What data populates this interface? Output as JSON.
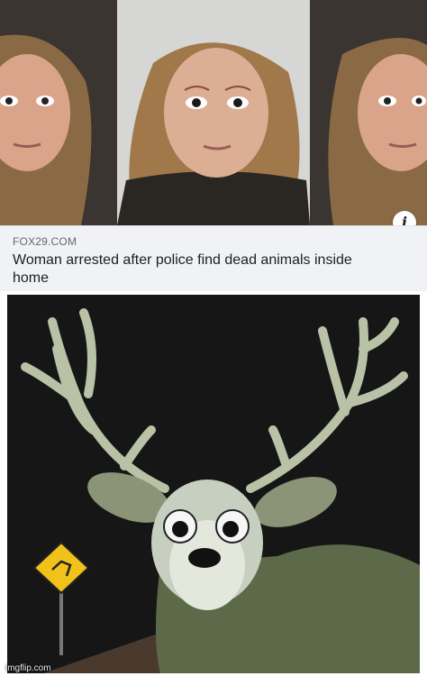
{
  "article": {
    "source": "FOX29.COM",
    "headline": "Woman arrested after police find dead animals inside home",
    "info_icon": "info-icon"
  },
  "meme": {
    "watermark": "imgflip.com"
  },
  "colors": {
    "card_bg": "#f0f2f5",
    "source_text": "#65676b",
    "headline_text": "#1c1e21"
  }
}
